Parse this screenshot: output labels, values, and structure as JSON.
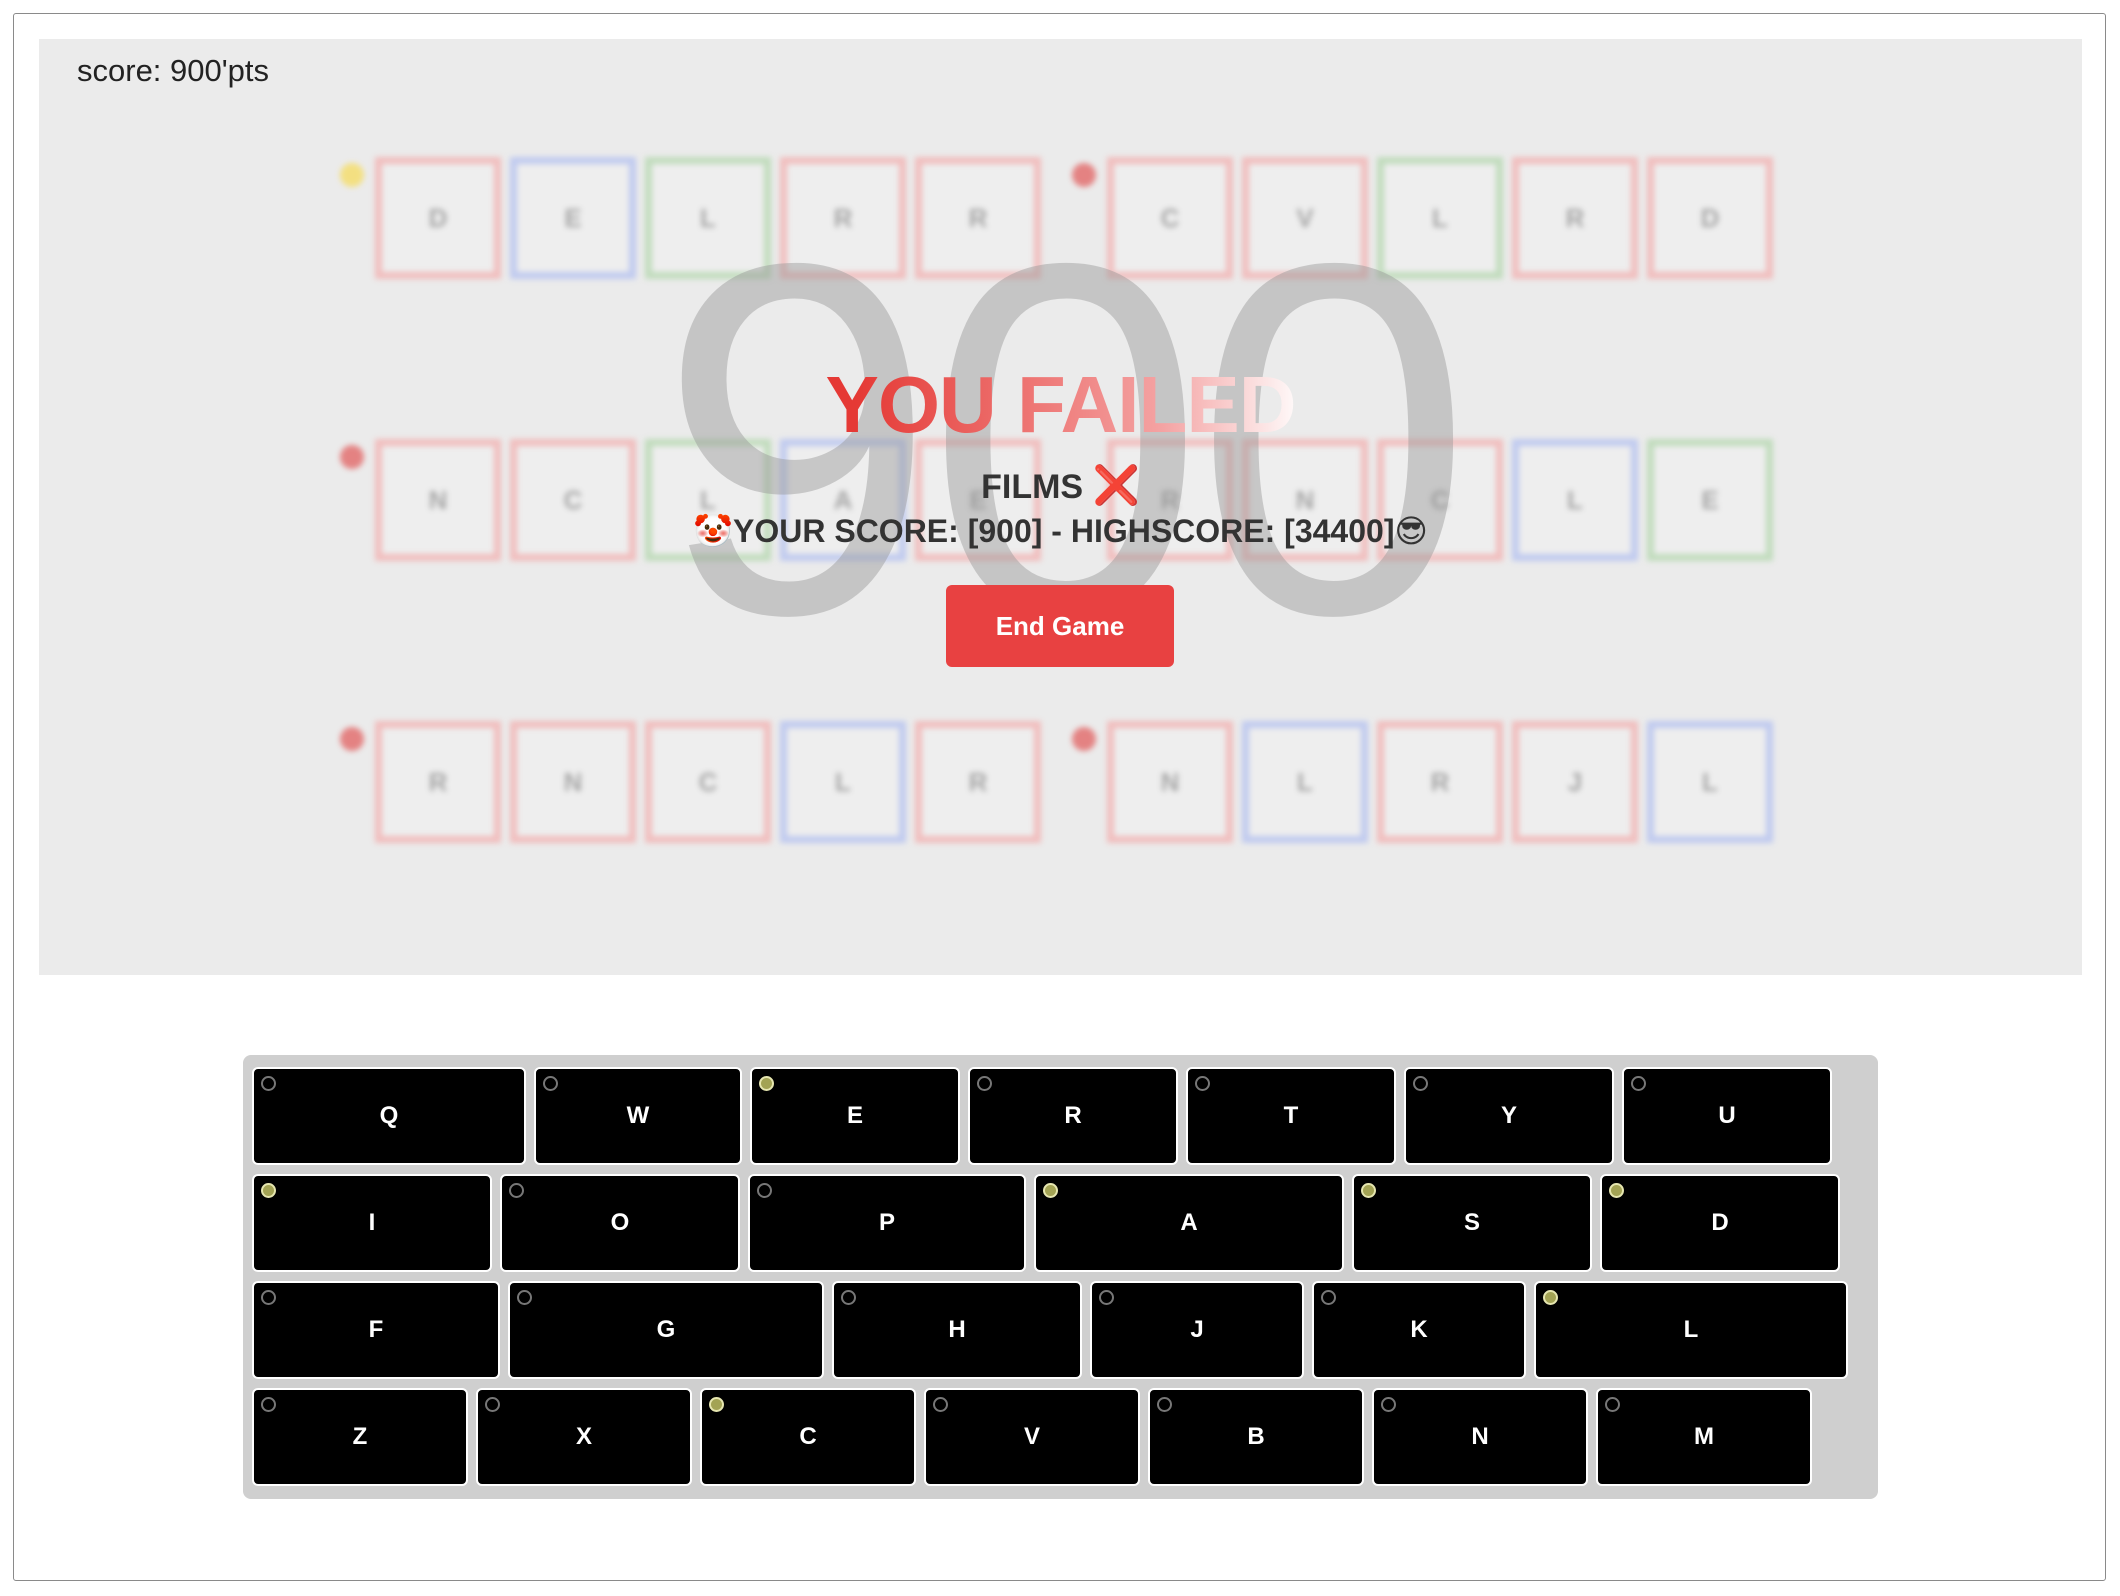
{
  "score_label": "score: 900'pts",
  "big_score": "900",
  "overlay": {
    "title": "YOU FAILED",
    "category": "FILMS",
    "category_mark": "❌",
    "score_line": "🤡YOUR SCORE: [900] - HIGHSCORE: [34400]😎",
    "end_button": "End Game"
  },
  "colors": {
    "red": "#f2b5b5",
    "blue": "#b8c4f0",
    "green": "#b9d9b4",
    "yellow": "#f5de6f",
    "dot_red": "#e37070",
    "button": "#e84141",
    "indicator_on": "#a3a354"
  },
  "board_rows": [
    {
      "words": [
        {
          "dot": "yellow",
          "tiles": [
            [
              "D",
              "red"
            ],
            [
              "E",
              "blue"
            ],
            [
              "L",
              "green"
            ],
            [
              "R",
              "red"
            ],
            [
              "R",
              "red"
            ]
          ]
        },
        {
          "dot": "dot_red",
          "tiles": [
            [
              "C",
              "red"
            ],
            [
              "V",
              "red"
            ],
            [
              "L",
              "green"
            ],
            [
              "R",
              "red"
            ],
            [
              "D",
              "red"
            ]
          ]
        }
      ]
    },
    {
      "words": [
        {
          "dot": "dot_red",
          "tiles": [
            [
              "N",
              "red"
            ],
            [
              "C",
              "red"
            ],
            [
              "L",
              "green"
            ],
            [
              "A",
              "blue"
            ],
            [
              "E",
              "red"
            ]
          ]
        },
        {
          "dot": "",
          "tiles": [
            [
              "R",
              "red"
            ],
            [
              "N",
              "red"
            ],
            [
              "C",
              "red"
            ],
            [
              "L",
              "blue"
            ],
            [
              "E",
              "green"
            ]
          ]
        }
      ]
    },
    {
      "words": [
        {
          "dot": "dot_red",
          "tiles": [
            [
              "R",
              "red"
            ],
            [
              "N",
              "red"
            ],
            [
              "C",
              "red"
            ],
            [
              "L",
              "blue"
            ],
            [
              "R",
              "red"
            ]
          ]
        },
        {
          "dot": "dot_red",
          "tiles": [
            [
              "N",
              "red"
            ],
            [
              "L",
              "blue"
            ],
            [
              "R",
              "red"
            ],
            [
              "J",
              "red"
            ],
            [
              "L",
              "blue"
            ]
          ]
        }
      ]
    }
  ],
  "keyboard": {
    "rows": [
      [
        {
          "k": "Q",
          "on": false
        },
        {
          "k": "W",
          "on": false
        },
        {
          "k": "E",
          "on": true
        },
        {
          "k": "R",
          "on": false
        },
        {
          "k": "T",
          "on": false
        },
        {
          "k": "Y",
          "on": false
        },
        {
          "k": "U",
          "on": false
        }
      ],
      [
        {
          "k": "I",
          "on": true
        },
        {
          "k": "O",
          "on": false
        },
        {
          "k": "P",
          "on": false
        },
        {
          "k": "A",
          "on": true
        },
        {
          "k": "S",
          "on": true
        },
        {
          "k": "D",
          "on": true
        }
      ],
      [
        {
          "k": "F",
          "on": false
        },
        {
          "k": "G",
          "on": false
        },
        {
          "k": "H",
          "on": false
        },
        {
          "k": "J",
          "on": false
        },
        {
          "k": "K",
          "on": false
        },
        {
          "k": "L",
          "on": true
        }
      ],
      [
        {
          "k": "Z",
          "on": false
        },
        {
          "k": "X",
          "on": false
        },
        {
          "k": "C",
          "on": true
        },
        {
          "k": "V",
          "on": false
        },
        {
          "k": "B",
          "on": false
        },
        {
          "k": "N",
          "on": false
        },
        {
          "k": "M",
          "on": false
        }
      ]
    ]
  }
}
